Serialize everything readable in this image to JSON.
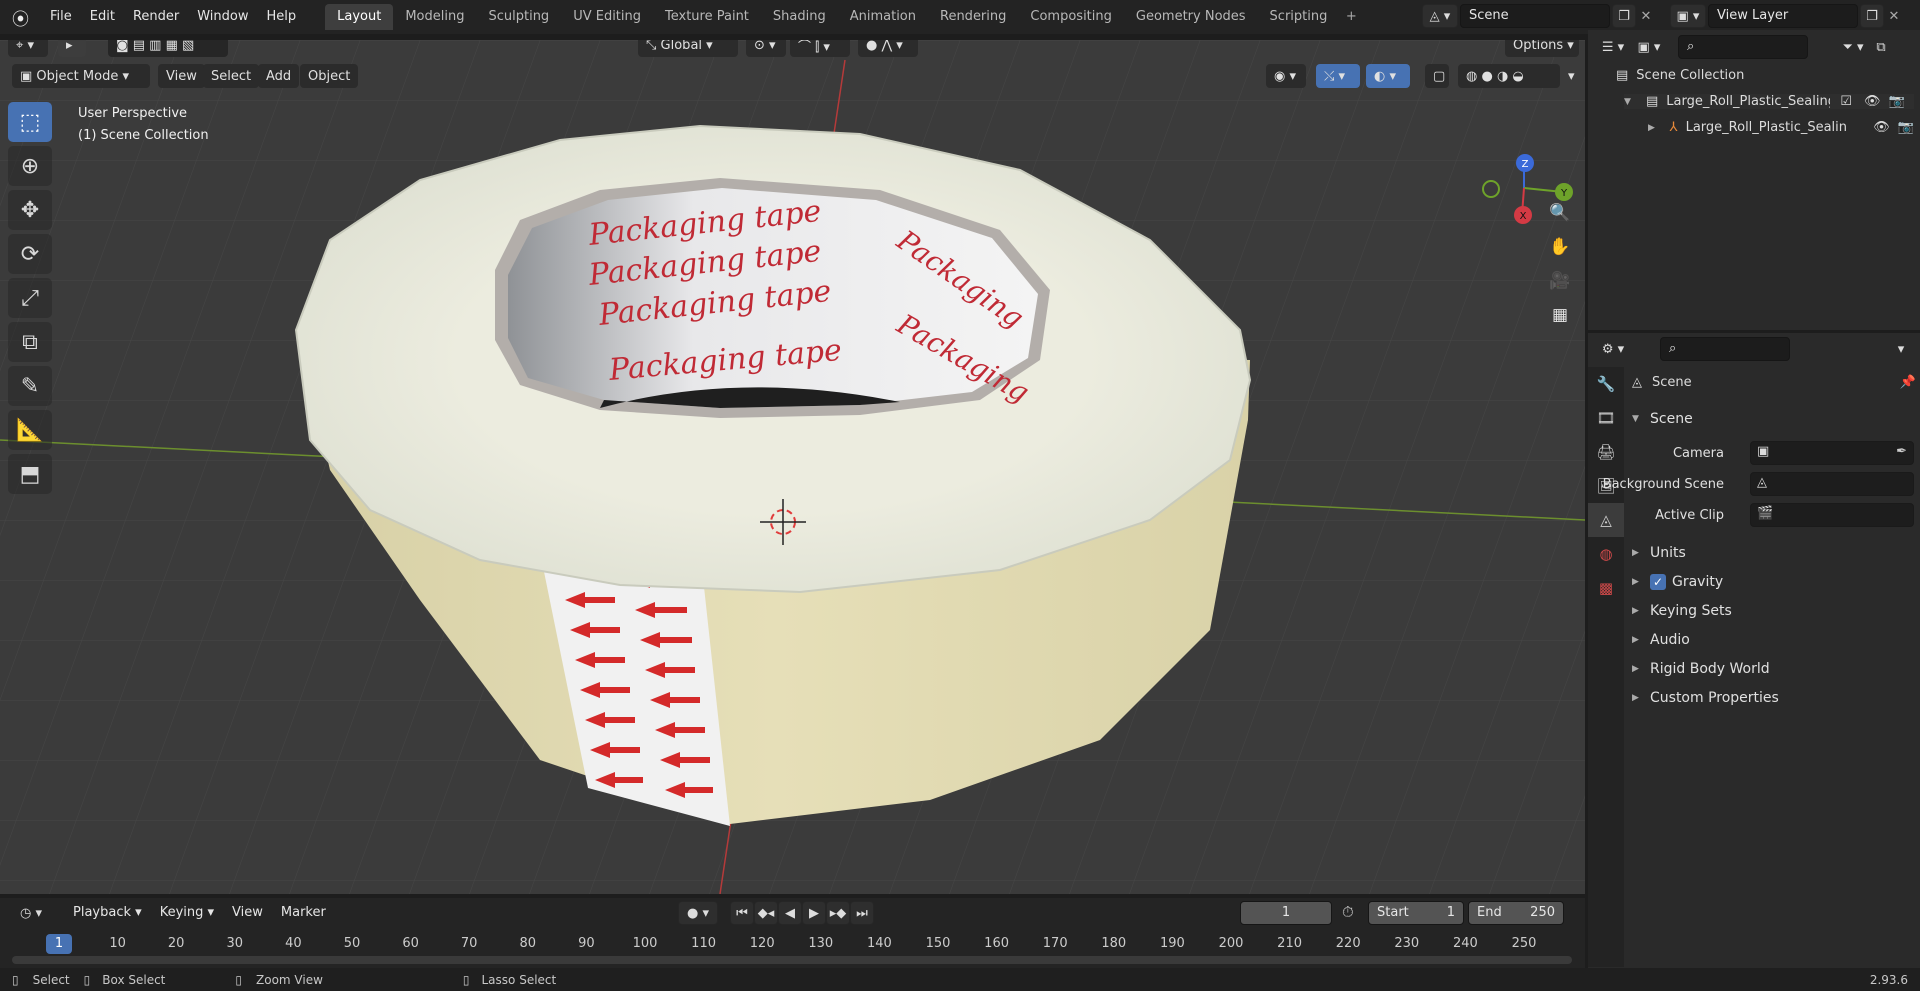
{
  "topbar": {
    "menu": [
      "File",
      "Edit",
      "Render",
      "Window",
      "Help"
    ],
    "tabs": [
      "Layout",
      "Modeling",
      "Sculpting",
      "UV Editing",
      "Texture Paint",
      "Shading",
      "Animation",
      "Rendering",
      "Compositing",
      "Geometry Nodes",
      "Scripting"
    ],
    "active_tab": "Layout",
    "scene_name": "Scene",
    "view_layer": "View Layer"
  },
  "viewport": {
    "mode": "Object Mode",
    "menus": [
      "View",
      "Select",
      "Add",
      "Object"
    ],
    "orientation": "Global",
    "options_label": "Options",
    "overlay_title": "User Perspective",
    "overlay_subtitle": "(1) Scene Collection",
    "tape_text": "Packaging tape",
    "tape_side_text": "Packaging",
    "gizmo_axes": [
      "Z",
      "Y",
      "X"
    ]
  },
  "outliner": {
    "root": "Scene Collection",
    "items": [
      {
        "label": "Large_Roll_Plastic_Sealing_Gl"
      },
      {
        "label": "Large_Roll_Plastic_Sealin"
      }
    ]
  },
  "properties": {
    "header": "Scene",
    "section": "Scene",
    "fields": [
      {
        "label": "Camera",
        "value": ""
      },
      {
        "label": "Background Scene",
        "value": ""
      },
      {
        "label": "Active Clip",
        "value": ""
      }
    ],
    "collapsed": [
      "Units",
      "Gravity",
      "Keying Sets",
      "Audio",
      "Rigid Body World",
      "Custom Properties"
    ],
    "gravity_checked": true
  },
  "timeline": {
    "menus": [
      "Playback",
      "Keying",
      "View",
      "Marker"
    ],
    "current_frame": "1",
    "start_label": "Start",
    "start": "1",
    "end_label": "End",
    "end": "250",
    "ruler": [
      "1",
      "10",
      "20",
      "30",
      "40",
      "50",
      "60",
      "70",
      "80",
      "90",
      "100",
      "110",
      "120",
      "130",
      "140",
      "150",
      "160",
      "170",
      "180",
      "190",
      "200",
      "210",
      "220",
      "230",
      "240",
      "250"
    ]
  },
  "statusbar": {
    "select": "Select",
    "box_select": "Box Select",
    "zoom_view": "Zoom View",
    "lasso_select": "Lasso Select",
    "version": "2.93.6"
  },
  "colors": {
    "accent": "#4772b3",
    "viewport_bg": "#3a3a3a",
    "tape_top": "#e7e8dc",
    "tape_side": "#e3dcb3",
    "tape_red": "#d42a2a"
  }
}
